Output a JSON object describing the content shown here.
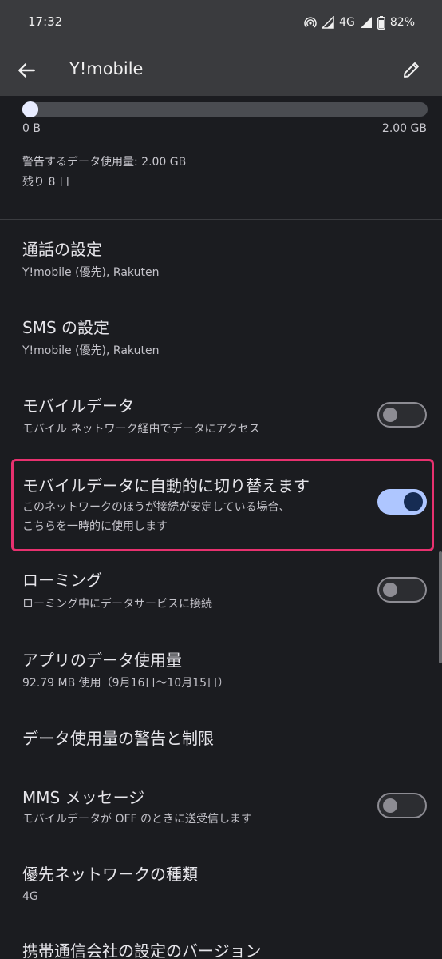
{
  "status_bar": {
    "time": "17:32",
    "network": "4G",
    "battery": "82%",
    "icons": [
      "hotspot-icon",
      "signal-icon",
      "signal-icon",
      "battery-icon"
    ]
  },
  "app_bar": {
    "title": "Y!mobile",
    "back_icon": "arrow-back-icon",
    "edit_icon": "pencil-icon"
  },
  "usage": {
    "min_label": "0 B",
    "max_label": "2.00 GB",
    "progress": 0.0,
    "warning_text": "警告するデータ使用量: 2.00 GB",
    "remaining_text": "残り 8 日"
  },
  "settings": {
    "call": {
      "title": "通話の設定",
      "subtitle": "Y!mobile (優先), Rakuten"
    },
    "sms": {
      "title": "SMS の設定",
      "subtitle": "Y!mobile (優先), Rakuten"
    },
    "mobile_data": {
      "title": "モバイルデータ",
      "subtitle": "モバイル ネットワーク経由でデータにアクセス",
      "enabled": false
    },
    "auto_switch": {
      "title": "モバイルデータに自動的に切り替えます",
      "subtitle_line1": "このネットワークのほうが接続が安定している場合、",
      "subtitle_line2": "こちらを一時的に使用します",
      "enabled": true
    },
    "roaming": {
      "title": "ローミング",
      "subtitle": "ローミング中にデータサービスに接続",
      "enabled": false
    },
    "app_data": {
      "title": "アプリのデータ使用量",
      "subtitle": "92.79 MB 使用（9月16日〜10月15日）"
    },
    "data_warning": {
      "title": "データ使用量の警告と制限"
    },
    "mms": {
      "title": "MMS メッセージ",
      "subtitle": "モバイルデータが OFF のときに送受信します",
      "enabled": false
    },
    "preferred_network": {
      "title": "優先ネットワークの種類",
      "subtitle": "4G"
    },
    "carrier_version": {
      "title": "携帯通信会社の設定のバージョン"
    }
  },
  "colors": {
    "background": "#1b1c20",
    "app_bar": "#3a3b3e",
    "toggle_on_track": "#aec6ff",
    "toggle_on_thumb": "#162c53",
    "highlight": "#e8316f"
  }
}
